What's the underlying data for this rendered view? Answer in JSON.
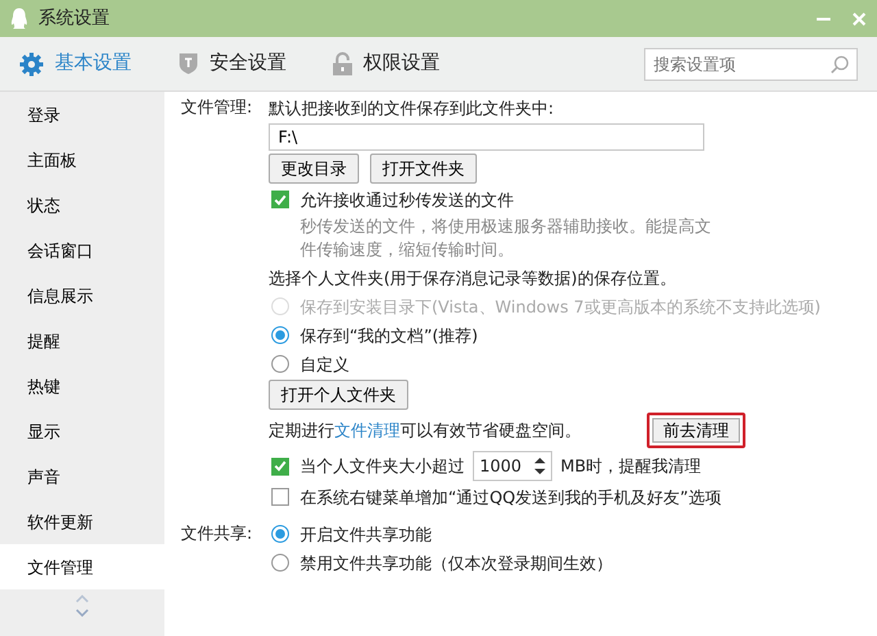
{
  "window": {
    "title": "系统设置"
  },
  "tabs": [
    {
      "label": "基本设置",
      "selected": true
    },
    {
      "label": "安全设置",
      "selected": false
    },
    {
      "label": "权限设置",
      "selected": false
    }
  ],
  "search": {
    "placeholder": "搜索设置项"
  },
  "sidebar": {
    "items": [
      {
        "label": "登录",
        "selected": false
      },
      {
        "label": "主面板",
        "selected": false
      },
      {
        "label": "状态",
        "selected": false
      },
      {
        "label": "会话窗口",
        "selected": false
      },
      {
        "label": "信息展示",
        "selected": false
      },
      {
        "label": "提醒",
        "selected": false
      },
      {
        "label": "热键",
        "selected": false
      },
      {
        "label": "显示",
        "selected": false
      },
      {
        "label": "声音",
        "selected": false
      },
      {
        "label": "软件更新",
        "selected": false
      },
      {
        "label": "文件管理",
        "selected": true
      }
    ]
  },
  "sections": [
    {
      "label": "文件管理:",
      "rows": [
        {
          "kind": "text",
          "text": "默认把接收到的文件保存到此文件夹中:"
        },
        {
          "kind": "field",
          "value": "F:\\"
        },
        {
          "kind": "buttons",
          "buttons": [
            "更改目录",
            "打开文件夹"
          ]
        },
        {
          "kind": "checkbox",
          "label": "允许接收通过秒传发送的文件",
          "checked": true
        },
        {
          "kind": "note",
          "text": "秒传发送的文件，将使用极速服务器辅助接收。能提高文件传输速度，缩短传输时间。"
        },
        {
          "kind": "text",
          "text": "选择个人文件夹(用于保存消息记录等数据)的保存位置。"
        },
        {
          "kind": "radio",
          "label": "保存到安装目录下(Vista、Windows 7或更高版本的系统不支持此选项)",
          "selected": false,
          "disabled": true
        },
        {
          "kind": "radio",
          "label": "保存到“我的文档”(推荐)",
          "selected": true,
          "disabled": false
        },
        {
          "kind": "radio",
          "label": "自定义",
          "selected": false,
          "disabled": false
        },
        {
          "kind": "buttons",
          "buttons": [
            "打开个人文件夹"
          ]
        },
        {
          "kind": "cleanup",
          "before": "定期进行",
          "link": "文件清理",
          "after": "可以有效节省硬盘空间。",
          "button": "前去清理",
          "highlighted": true
        },
        {
          "kind": "spin",
          "checked": true,
          "before": "当个人文件夹大小超过",
          "value": "1000",
          "after": "MB时，提醒我清理"
        },
        {
          "kind": "checkbox",
          "label": "在系统右键菜单增加“通过QQ发送到我的手机及好友”选项",
          "checked": false
        }
      ]
    },
    {
      "label": "文件共享:",
      "rows": [
        {
          "kind": "radio",
          "label": "开启文件共享功能",
          "selected": true,
          "disabled": false
        },
        {
          "kind": "radio",
          "label": "禁用文件共享功能（仅本次登录期间生效）",
          "selected": false,
          "disabled": false
        }
      ]
    }
  ]
}
